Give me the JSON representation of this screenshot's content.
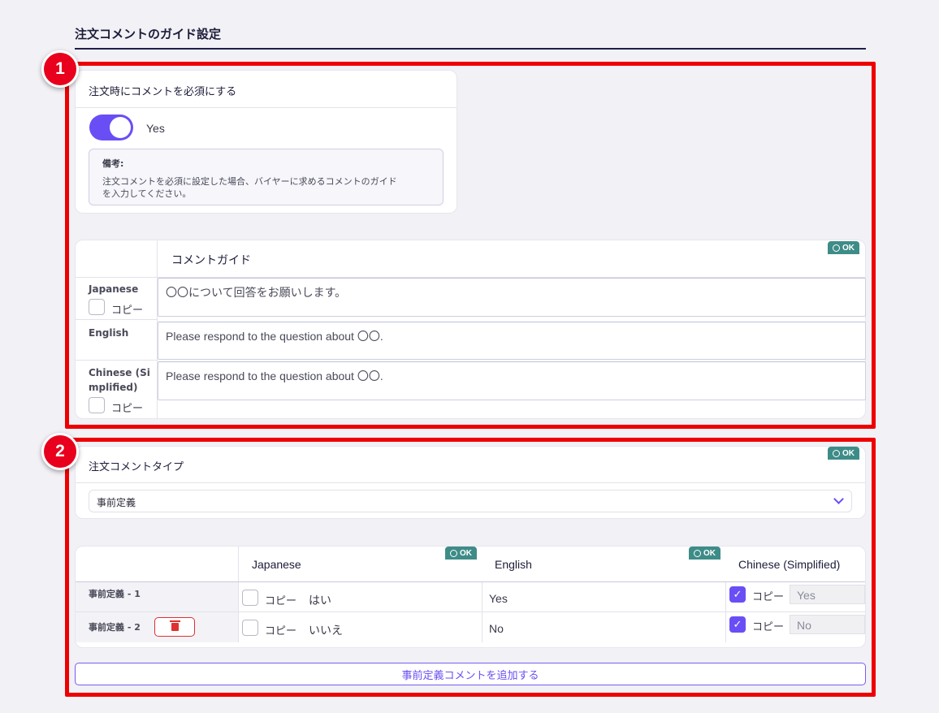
{
  "page": {
    "section_title": "注文コメントのガイド設定"
  },
  "markers": [
    "1",
    "2"
  ],
  "required_comment": {
    "title": "注文時にコメントを必須にする",
    "toggle_on": true,
    "toggle_label": "Yes",
    "note_title": "備考:",
    "note_text_1": "注文コメントを必須に設定した場合、バイヤーに求めるコメントのガイド",
    "note_text_2": "を入力してください。"
  },
  "comment_guide": {
    "badge": "OK",
    "header": "コメントガイド",
    "copy_label": "コピー",
    "rows": [
      {
        "label": "Japanese",
        "label_line2": "",
        "has_copy": true,
        "value": "〇〇について回答をお願いします。"
      },
      {
        "label": "English",
        "label_line2": "",
        "has_copy": false,
        "value": "Please respond to the question about 〇〇."
      },
      {
        "label": "Chinese (Si",
        "label_line2": "mplified)",
        "has_copy": true,
        "value": "Please respond to the question about 〇〇."
      }
    ]
  },
  "comment_type": {
    "title": "注文コメントタイプ",
    "badge": "OK",
    "selected": "事前定義",
    "icon": "chevron-down-icon"
  },
  "predefined_table": {
    "columns": [
      {
        "label": "Japanese",
        "badge": "OK"
      },
      {
        "label": "English",
        "badge": "OK"
      },
      {
        "label": "Chinese (Simplified)"
      }
    ],
    "copy_label": "コピー",
    "rows": [
      {
        "label": "事前定義 - 1",
        "ja": "はい",
        "en": "Yes",
        "zh": "Yes",
        "zh_copy": true,
        "deletable": false
      },
      {
        "label": "事前定義 - 2",
        "ja": "いいえ",
        "en": "No",
        "zh": "No",
        "zh_copy": true,
        "deletable": true
      }
    ],
    "add_button": "事前定義コメントを追加する"
  },
  "colors": {
    "accent": "#6a4ef5",
    "ok_badge": "#3e8c88",
    "highlight_frame": "#ee0000"
  }
}
